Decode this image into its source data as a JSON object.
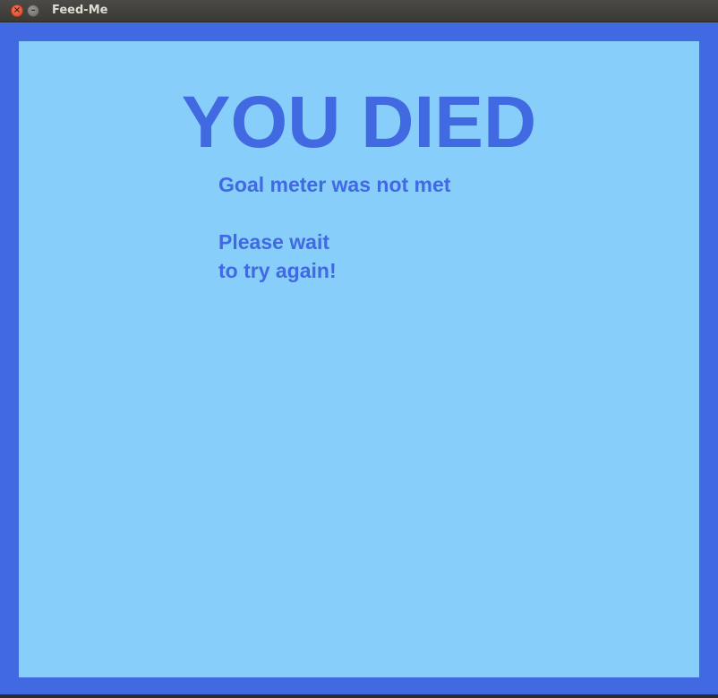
{
  "window": {
    "title": "Feed-Me",
    "close_glyph": "×",
    "minimize_glyph": "–"
  },
  "game": {
    "headline": "YOU DIED",
    "reason": "Goal meter was not met",
    "wait_line1": "Please wait",
    "wait_line2": "to try again!"
  },
  "colors": {
    "frame": "#4169e1",
    "panel": "#87cefa",
    "text": "#4169e1"
  }
}
